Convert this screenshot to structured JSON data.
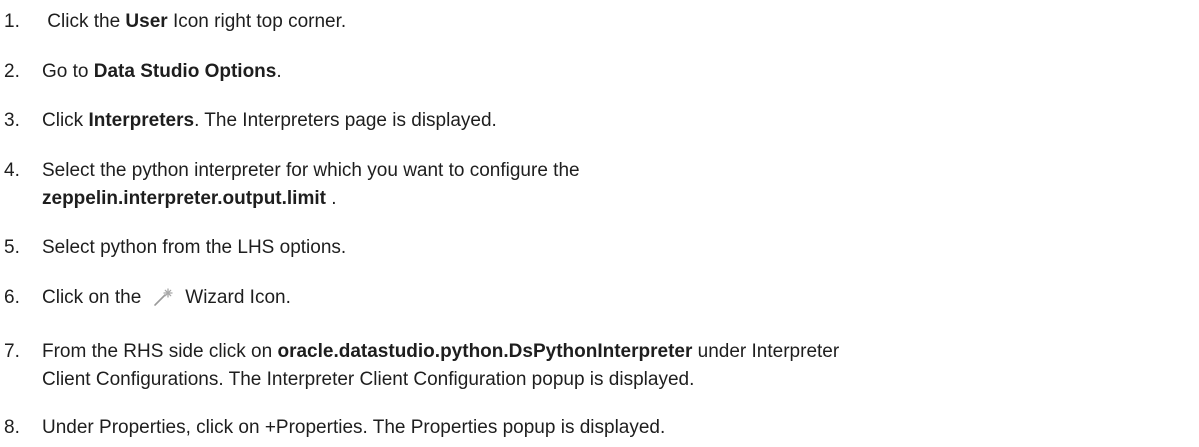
{
  "steps": [
    {
      "num": "1.",
      "pre": " Click the ",
      "bold": "User",
      "post": " Icon right top corner."
    },
    {
      "num": "2.",
      "pre": "Go to ",
      "bold": "Data Studio Options",
      "post": "."
    },
    {
      "num": "3.",
      "pre": "Click ",
      "bold": "Interpreters",
      "post": ". The Interpreters page is displayed."
    },
    {
      "num": "4.",
      "line1": "Select the python interpreter for which you want to configure the",
      "bold": "zeppelin.interpreter.output.limit",
      "post": " ."
    },
    {
      "num": "5.",
      "text": "Select python from the LHS options."
    },
    {
      "num": "6.",
      "pre": "Click on the",
      "icon": "wizard-icon",
      "post": "Wizard Icon."
    },
    {
      "num": "7.",
      "pre": "From the RHS side click on ",
      "bold": "oracle.datastudio.python.DsPythonInterpreter",
      "post": " under Interpreter",
      "line2": "Client Configurations. The Interpreter Client Configuration popup is displayed."
    },
    {
      "num": "8.",
      "text": "Under Properties, click on +Properties. The Properties popup is displayed."
    }
  ]
}
